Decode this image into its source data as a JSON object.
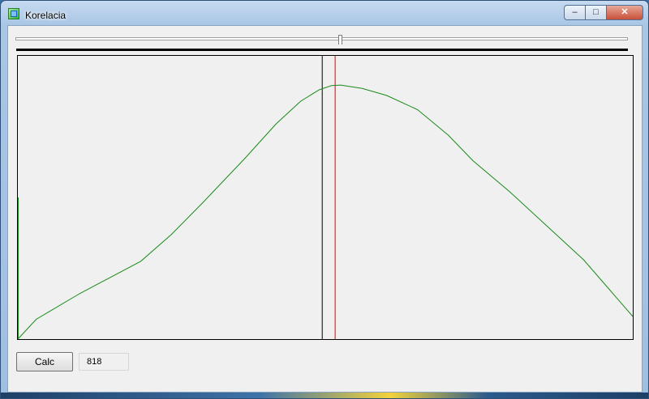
{
  "window": {
    "title": "Korelacia",
    "minimize_glyph": "–",
    "maximize_glyph": "□",
    "close_glyph": "✕"
  },
  "slider": {
    "position_fraction": 0.53
  },
  "controls": {
    "calc_label": "Calc",
    "value_text": "818"
  },
  "colors": {
    "curve": "#1a8a1a",
    "marker_red": "#e00000",
    "marker_black": "#000000"
  },
  "chart_data": {
    "type": "line",
    "xlim": [
      0,
      1
    ],
    "ylim": [
      0,
      1
    ],
    "grid": false,
    "markers": {
      "black_x": 0.495,
      "red_x": 0.516
    },
    "series": [
      {
        "x": [
          0,
          0.03,
          0.1,
          0.2,
          0.25,
          0.3,
          0.37,
          0.42,
          0.46,
          0.49,
          0.51,
          0.525,
          0.56,
          0.6,
          0.65,
          0.7,
          0.74,
          0.8,
          0.86,
          0.92,
          0.96,
          1.0
        ],
        "values": [
          0.0,
          0.07,
          0.16,
          0.275,
          0.37,
          0.48,
          0.64,
          0.76,
          0.84,
          0.88,
          0.895,
          0.897,
          0.885,
          0.86,
          0.81,
          0.72,
          0.63,
          0.52,
          0.4,
          0.28,
          0.18,
          0.08
        ]
      }
    ]
  }
}
